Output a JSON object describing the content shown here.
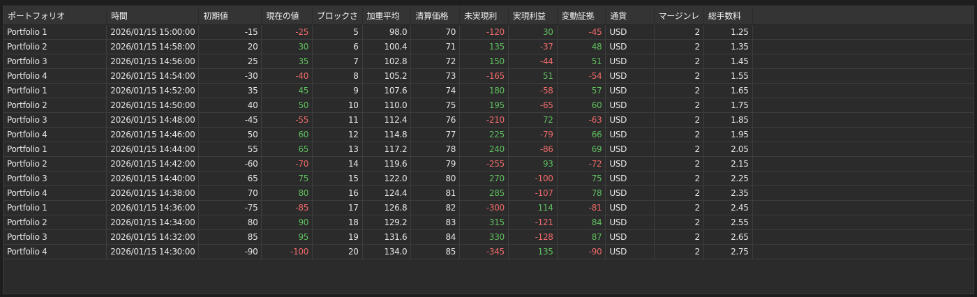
{
  "colors": {
    "positive": "#5fbf5f",
    "negative": "#f06a6a"
  },
  "columns": [
    "ポートフォリオ",
    "時間",
    "初期値",
    "現在の値",
    "ブロックさ",
    "加重平均",
    "清算価格",
    "未実現利",
    "実現利益",
    "変動証拠",
    "通貨",
    "マージンレ",
    "総手数料"
  ],
  "rows": [
    [
      "Portfolio 1",
      "2026/01/15 15:00:00",
      "-15",
      "-25",
      "5",
      "98.0",
      "70",
      "-120",
      "30",
      "-45",
      "USD",
      "2",
      "1.25"
    ],
    [
      "Portfolio 2",
      "2026/01/15 14:58:00",
      "20",
      "30",
      "6",
      "100.4",
      "71",
      "135",
      "-37",
      "48",
      "USD",
      "2",
      "1.35"
    ],
    [
      "Portfolio 3",
      "2026/01/15 14:56:00",
      "25",
      "35",
      "7",
      "102.8",
      "72",
      "150",
      "-44",
      "51",
      "USD",
      "2",
      "1.45"
    ],
    [
      "Portfolio 4",
      "2026/01/15 14:54:00",
      "-30",
      "-40",
      "8",
      "105.2",
      "73",
      "-165",
      "51",
      "-54",
      "USD",
      "2",
      "1.55"
    ],
    [
      "Portfolio 1",
      "2026/01/15 14:52:00",
      "35",
      "45",
      "9",
      "107.6",
      "74",
      "180",
      "-58",
      "57",
      "USD",
      "2",
      "1.65"
    ],
    [
      "Portfolio 2",
      "2026/01/15 14:50:00",
      "40",
      "50",
      "10",
      "110.0",
      "75",
      "195",
      "-65",
      "60",
      "USD",
      "2",
      "1.75"
    ],
    [
      "Portfolio 3",
      "2026/01/15 14:48:00",
      "-45",
      "-55",
      "11",
      "112.4",
      "76",
      "-210",
      "72",
      "-63",
      "USD",
      "2",
      "1.85"
    ],
    [
      "Portfolio 4",
      "2026/01/15 14:46:00",
      "50",
      "60",
      "12",
      "114.8",
      "77",
      "225",
      "-79",
      "66",
      "USD",
      "2",
      "1.95"
    ],
    [
      "Portfolio 1",
      "2026/01/15 14:44:00",
      "55",
      "65",
      "13",
      "117.2",
      "78",
      "240",
      "-86",
      "69",
      "USD",
      "2",
      "2.05"
    ],
    [
      "Portfolio 2",
      "2026/01/15 14:42:00",
      "-60",
      "-70",
      "14",
      "119.6",
      "79",
      "-255",
      "93",
      "-72",
      "USD",
      "2",
      "2.15"
    ],
    [
      "Portfolio 3",
      "2026/01/15 14:40:00",
      "65",
      "75",
      "15",
      "122.0",
      "80",
      "270",
      "-100",
      "75",
      "USD",
      "2",
      "2.25"
    ],
    [
      "Portfolio 4",
      "2026/01/15 14:38:00",
      "70",
      "80",
      "16",
      "124.4",
      "81",
      "285",
      "-107",
      "78",
      "USD",
      "2",
      "2.35"
    ],
    [
      "Portfolio 1",
      "2026/01/15 14:36:00",
      "-75",
      "-85",
      "17",
      "126.8",
      "82",
      "-300",
      "114",
      "-81",
      "USD",
      "2",
      "2.45"
    ],
    [
      "Portfolio 2",
      "2026/01/15 14:34:00",
      "80",
      "90",
      "18",
      "129.2",
      "83",
      "315",
      "-121",
      "84",
      "USD",
      "2",
      "2.55"
    ],
    [
      "Portfolio 3",
      "2026/01/15 14:32:00",
      "85",
      "95",
      "19",
      "131.6",
      "84",
      "330",
      "-128",
      "87",
      "USD",
      "2",
      "2.65"
    ],
    [
      "Portfolio 4",
      "2026/01/15 14:30:00",
      "-90",
      "-100",
      "20",
      "134.0",
      "85",
      "-345",
      "135",
      "-90",
      "USD",
      "2",
      "2.75"
    ]
  ]
}
